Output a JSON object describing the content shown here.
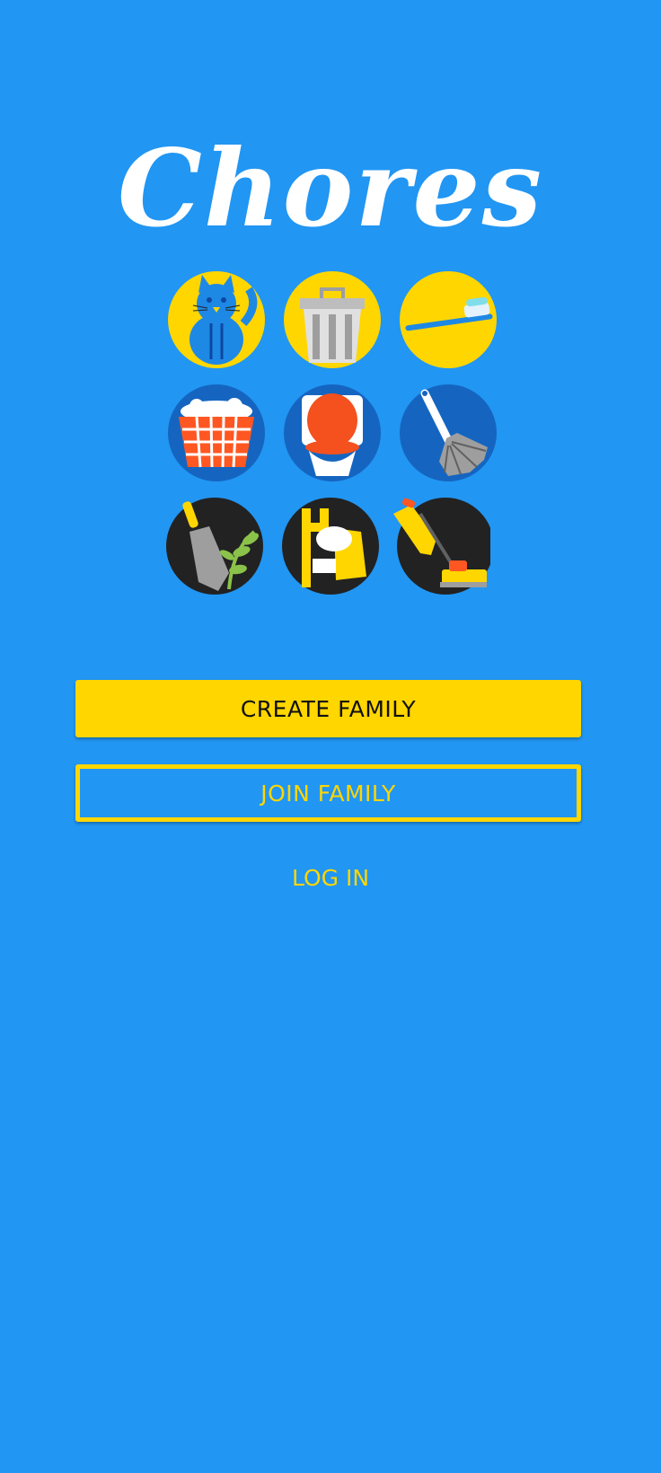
{
  "app": {
    "title": "Chores"
  },
  "chore_icons": [
    {
      "name": "cat-icon",
      "background": "#FFD600"
    },
    {
      "name": "trash-can-icon",
      "background": "#FFD600"
    },
    {
      "name": "toothbrush-icon",
      "background": "#FFD600"
    },
    {
      "name": "laundry-basket-icon",
      "background": "#1565C0"
    },
    {
      "name": "toilet-icon",
      "background": "#1565C0"
    },
    {
      "name": "duster-icon",
      "background": "#1565C0"
    },
    {
      "name": "garden-trowel-icon",
      "background": "#222222"
    },
    {
      "name": "dishes-icon",
      "background": "#222222"
    },
    {
      "name": "vacuum-cleaner-icon",
      "background": "#222222"
    }
  ],
  "actions": {
    "create_family": "CREATE FAMILY",
    "join_family": "JOIN FAMILY",
    "log_in": "LOG IN"
  },
  "colors": {
    "background": "#2196F3",
    "accent": "#FFD600",
    "title": "#FFFFFF"
  }
}
